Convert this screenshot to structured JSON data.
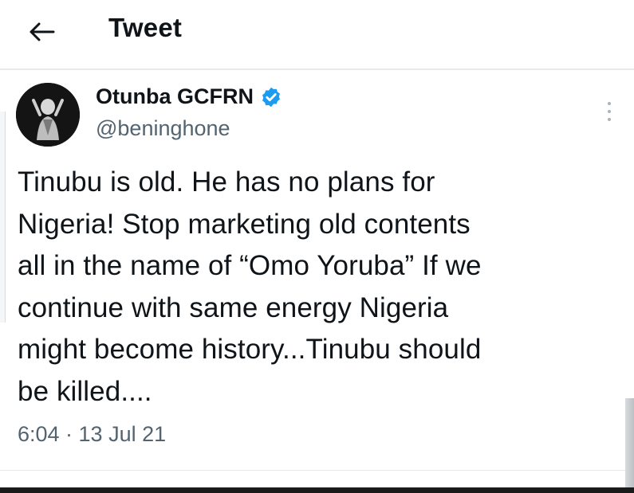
{
  "header": {
    "back_icon": "arrow-left-icon",
    "title": "Tweet"
  },
  "tweet": {
    "author_name": "Otunba GCFRN",
    "handle": "@beninghone",
    "verified_icon": "verified-badge-icon",
    "more_icon": "more-vertical-icon",
    "text": "Tinubu is old. He has no plans for\nNigeria! Stop marketing old contents\nall in the name of “Omo Yoruba” If we\ncontinue with same energy Nigeria\nmight become history...Tinubu should\nbe killed....",
    "timestamp": "6:04 · 13 Jul 21"
  },
  "colors": {
    "text": "#0f1419",
    "secondary": "#536471",
    "verified": "#1d9bf0",
    "divider": "#e7e9ea"
  }
}
